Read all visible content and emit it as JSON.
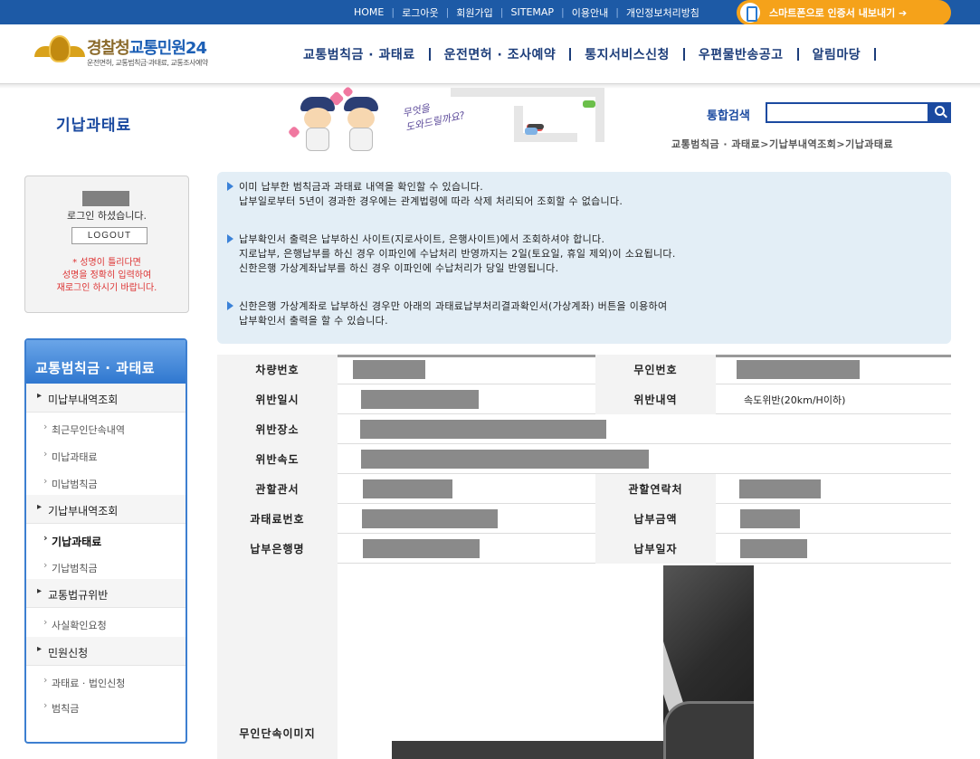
{
  "topbar": {
    "links": [
      "HOME",
      "로그아웃",
      "회원가입",
      "SITEMAP",
      "이용안내",
      "개인정보처리방침"
    ],
    "smart_button": "스마트폰으로 인증서 내보내기 ➔"
  },
  "header": {
    "logo_brand_main": "경찰청",
    "logo_brand_blue": "교통민원24",
    "logo_tagline": "운전면허, 교통범칙금·과태료, 교통조사예약",
    "gnb": [
      "교통범칙금 · 과태료",
      "운전면허 · 조사예약",
      "통지서비스신청",
      "우편물반송공고",
      "알림마당"
    ]
  },
  "subheader": {
    "page_title": "기납과태료",
    "bubble_line1": "무엇을",
    "bubble_line2": "도와드릴까요?",
    "search_label": "통합검색",
    "search_value": "",
    "breadcrumb": "교통범칙금 · 과태료>기납부내역조회>기납과태료"
  },
  "login": {
    "logged_text": "로그인 하셨습니다.",
    "logout_label": "LOGOUT",
    "warning": [
      "* 성명이 틀리다면",
      "성명을 정확히 입력하여",
      "재로그인 하시기 바랍니다."
    ]
  },
  "sidenav": {
    "title": "교통범칙금 · 과태료",
    "items": [
      {
        "label": "미납부내역조회",
        "level": "main"
      },
      {
        "label": "최근무인단속내역",
        "level": "sub"
      },
      {
        "label": "미납과태료",
        "level": "sub"
      },
      {
        "label": "미납범칙금",
        "level": "sub"
      },
      {
        "label": "기납부내역조회",
        "level": "main"
      },
      {
        "label": "기납과태료",
        "level": "sub",
        "active": true
      },
      {
        "label": "기납범칙금",
        "level": "sub"
      },
      {
        "label": "교통법규위반",
        "level": "main"
      },
      {
        "label": "사실확인요청",
        "level": "sub"
      },
      {
        "label": "민원신청",
        "level": "main"
      },
      {
        "label": "과태료 · 법인신청",
        "level": "sub"
      },
      {
        "label": "범칙금",
        "level": "sub"
      }
    ]
  },
  "info": {
    "para1": [
      "이미 납부한 범칙금과 과태료 내역을 확인할 수 있습니다.",
      "납부일로부터 5년이 경과한 경우에는 관계법령에 따라 삭제 처리되어 조회할 수 없습니다."
    ],
    "para2": [
      "납부확인서 출력은 납부하신 사이트(지로사이트, 은행사이트)에서 조회하셔야 합니다.",
      "지로납부, 은행납부를 하신 경우 이파인에 수납처리 반영까지는 2일(토요일, 휴일 제외)이 소요됩니다.",
      "신한은행 가상계좌납부를 하신 경우 이파인에 수납처리가 당일 반영됩니다."
    ],
    "para3": [
      "신한은행 가상계좌로 납부하신 경우만 아래의 과태료납부처리결과확인서(가상계좌) 버튼을 이용하여",
      "납부확인서 출력을 할 수 있습니다."
    ]
  },
  "details": {
    "vehicle_label": "차량번호",
    "camera_label": "무인번호",
    "date_label": "위반일시",
    "violation_label": "위반내역",
    "violation_value": "속도위반(20km/H이하)",
    "place_label": "위반장소",
    "speed_label": "위반속도",
    "office_label": "관할관서",
    "contact_label": "관할연락처",
    "fine_no_label": "과태료번호",
    "amount_label": "납부금액",
    "bank_label": "납부은행명",
    "paydate_label": "납부일자",
    "image_label": "무인단속이미지"
  },
  "colors": {
    "primary_blue": "#1b4aa0",
    "topbar_blue": "#1d5aa6",
    "orange": "#f5a21a",
    "info_bg": "#e3eef6",
    "warn_red": "#dd3333"
  }
}
